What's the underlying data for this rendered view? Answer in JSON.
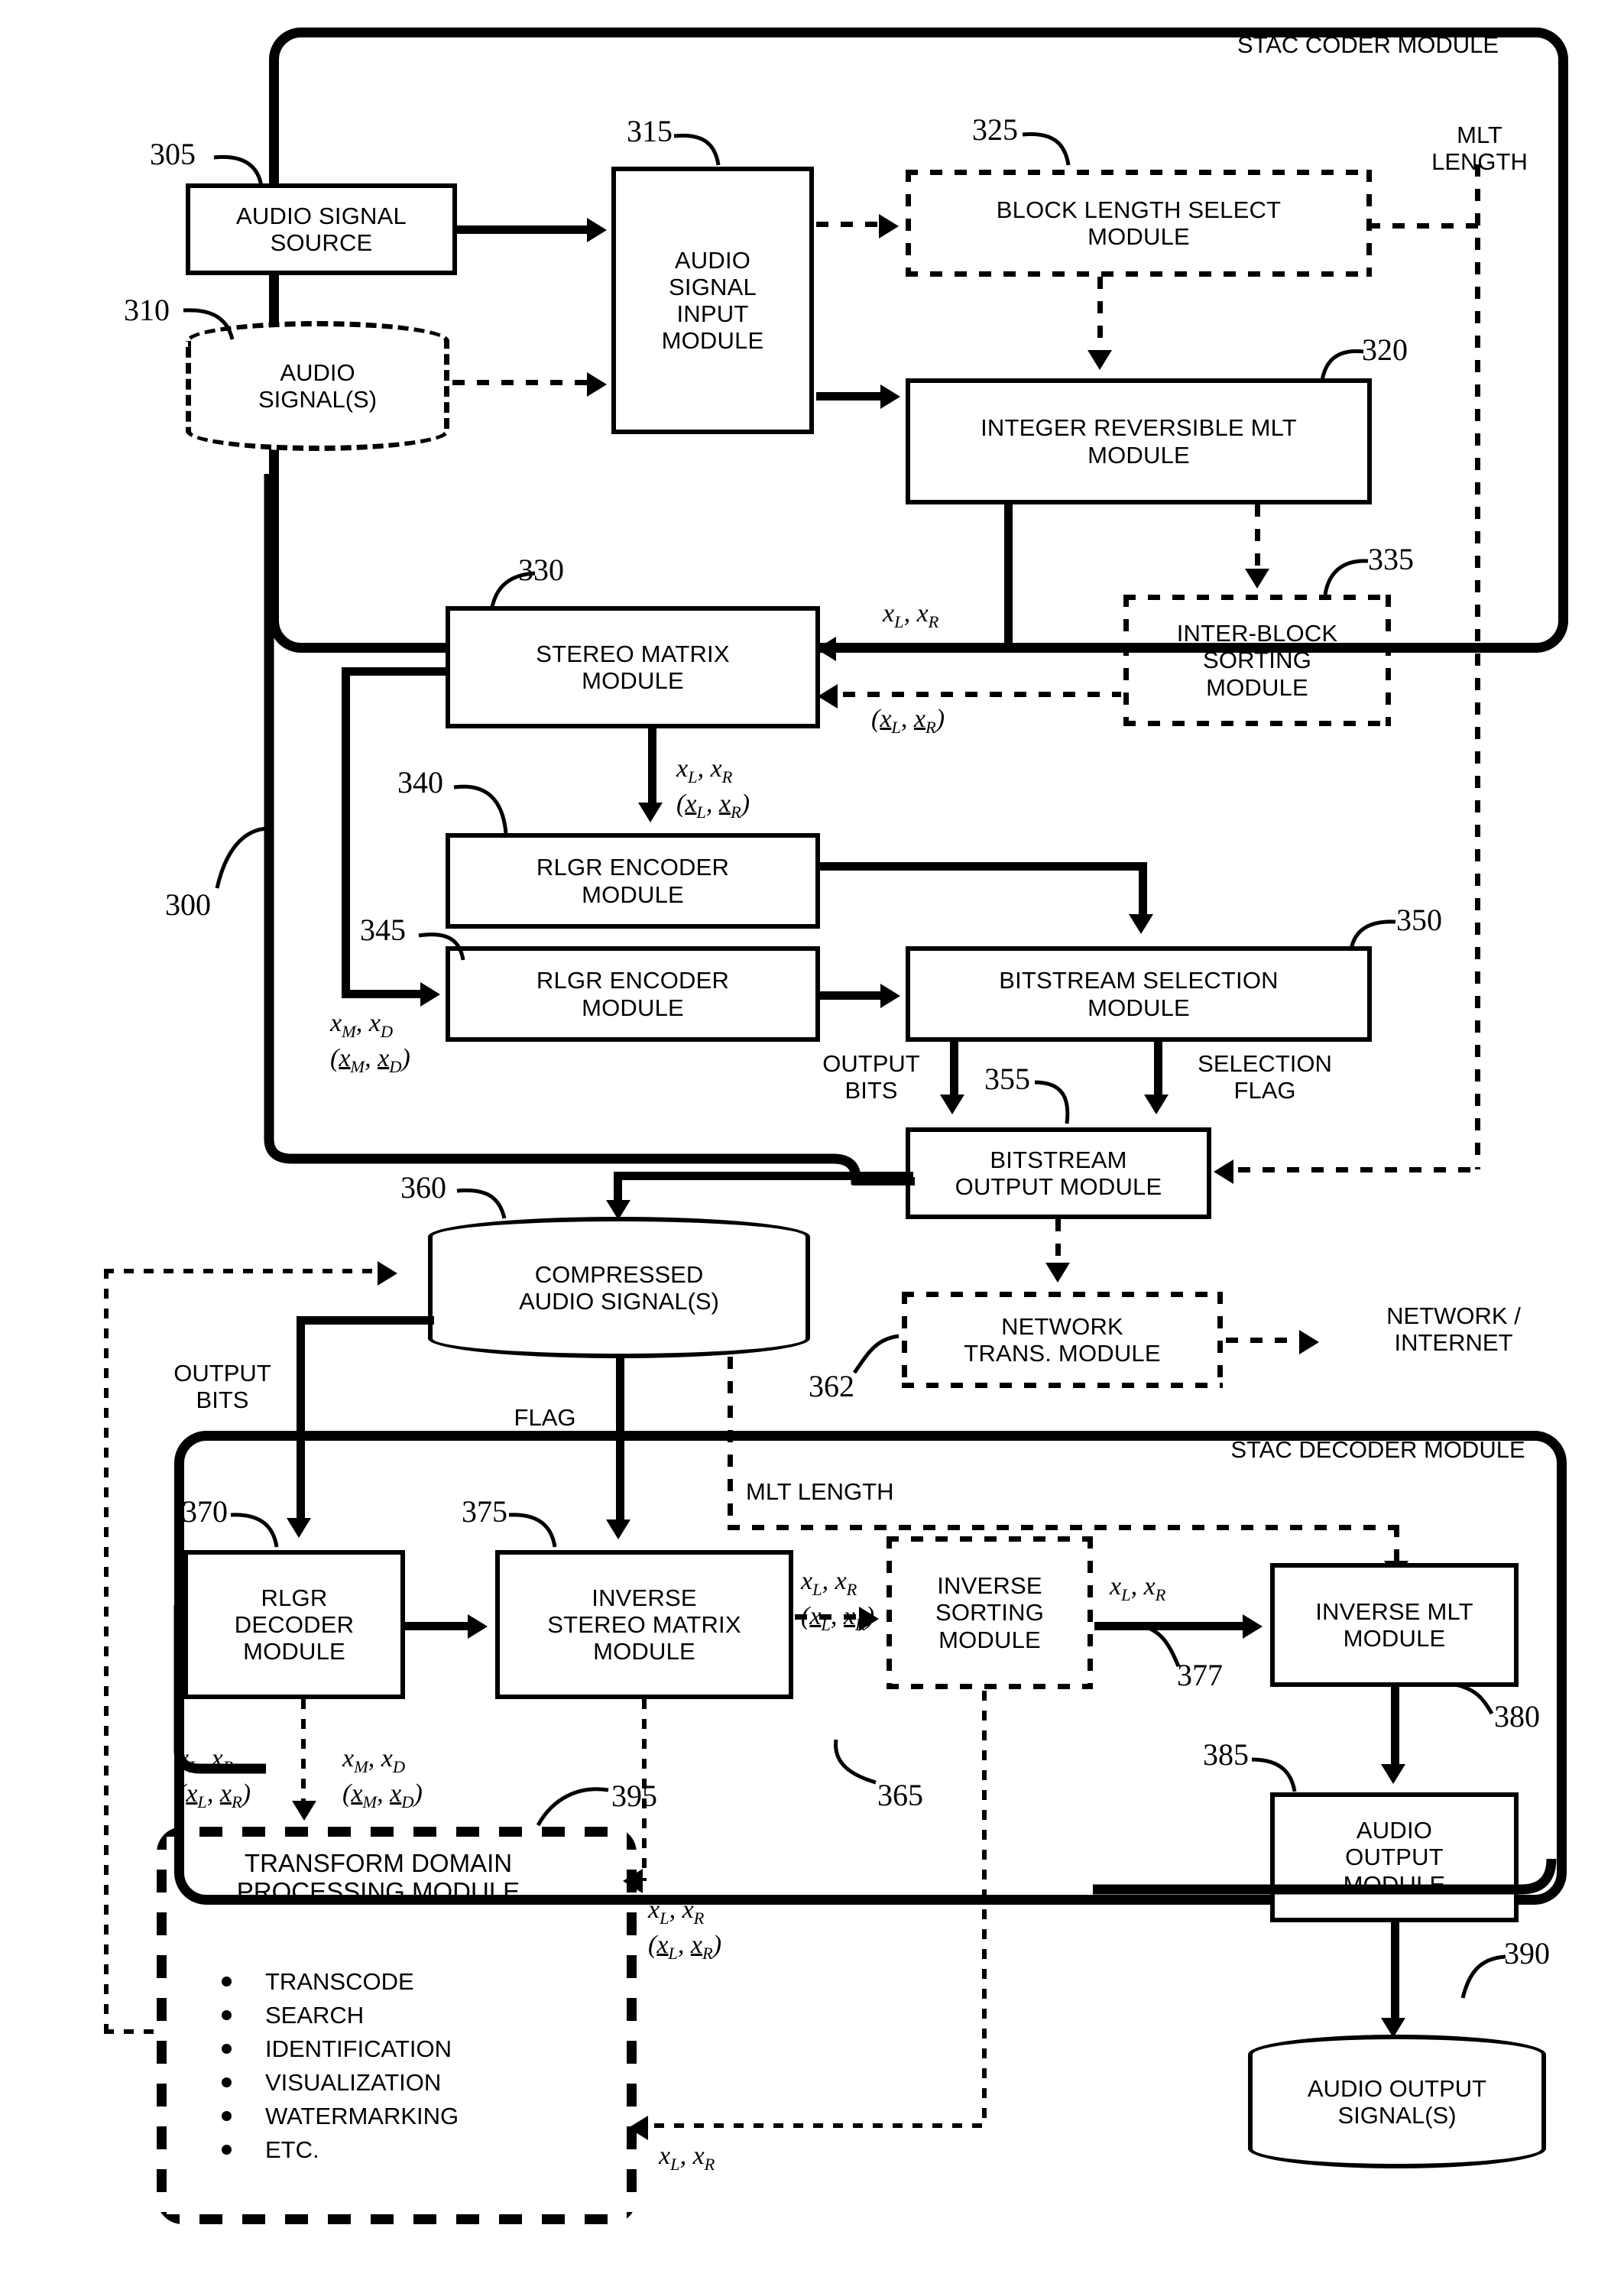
{
  "figure": {
    "coder_frame_label": "STAC CODER MODULE",
    "decoder_frame_label": "STAC DECODER MODULE",
    "system_ref": "300"
  },
  "coder": {
    "audio_signal_source": {
      "label": "AUDIO SIGNAL\nSOURCE",
      "ref": "305"
    },
    "audio_signals_store": {
      "label": "AUDIO\nSIGNAL(S)",
      "ref": "310"
    },
    "audio_signal_input": {
      "label": "AUDIO\nSIGNAL\nINPUT\nMODULE",
      "ref": "315"
    },
    "block_length_select": {
      "label": "BLOCK LENGTH SELECT\nMODULE",
      "ref": "325"
    },
    "integer_reversible_mlt": {
      "label": "INTEGER REVERSIBLE MLT\nMODULE",
      "ref": "320"
    },
    "inter_block_sorting": {
      "label": "INTER-BLOCK\nSORTING\nMODULE",
      "ref": "335"
    },
    "stereo_matrix": {
      "label": "STEREO MATRIX\nMODULE",
      "ref": "330"
    },
    "rlgr_encoder_1": {
      "label": "RLGR ENCODER\nMODULE",
      "ref": "340"
    },
    "rlgr_encoder_2": {
      "label": "RLGR ENCODER\nMODULE",
      "ref": "345"
    },
    "bitstream_selection": {
      "label": "BITSTREAM SELECTION\nMODULE",
      "ref": "350"
    },
    "bitstream_output": {
      "label": "BITSTREAM\nOUTPUT MODULE",
      "ref": "355"
    },
    "network_trans": {
      "label": "NETWORK\nTRANS. MODULE",
      "ref": "362"
    }
  },
  "decoder": {
    "compressed_store": {
      "label": "COMPRESSED\nAUDIO SIGNAL(S)",
      "ref": "360"
    },
    "rlgr_decoder": {
      "label": "RLGR\nDECODER\nMODULE",
      "ref": "370"
    },
    "inverse_stereo_matrix": {
      "label": "INVERSE\nSTEREO MATRIX\nMODULE",
      "ref": "375"
    },
    "inverse_sorting": {
      "label": "INVERSE\nSORTING\nMODULE",
      "ref": "377"
    },
    "inverse_mlt": {
      "label": "INVERSE MLT\nMODULE",
      "ref": "380"
    },
    "audio_output_module": {
      "label": "AUDIO\nOUTPUT\nMODULE",
      "ref": "385"
    },
    "audio_output_store": {
      "label": "AUDIO OUTPUT\nSIGNAL(S)",
      "ref": "390"
    },
    "decoder_ref": "365",
    "transform_domain": {
      "label": "TRANSFORM DOMAIN\nPROCESSING MODULE",
      "ref": "395",
      "items": [
        "TRANSCODE",
        "SEARCH",
        "IDENTIFICATION",
        "VISUALIZATION",
        "WATERMARKING",
        "ETC."
      ]
    }
  },
  "signal_labels": {
    "mlt_length_top": "MLT\nLENGTH",
    "mlt_length_mid": "MLT LENGTH",
    "output_bits_coder": "OUTPUT\nBITS",
    "output_bits_decoder": "OUTPUT\nBITS",
    "selection_flag": "SELECTION\nFLAG",
    "flag": "FLAG",
    "network_internet": "NETWORK /\nINTERNET"
  },
  "math_labels": {
    "xlr_plain": "x_L, x_R",
    "xlr_under": "(x_L, x_R)",
    "xmd_plain": "x_M, x_D",
    "xmd_under": "(x_M, x_D)"
  },
  "colors": {
    "ink": "#000000",
    "paper": "#ffffff"
  }
}
